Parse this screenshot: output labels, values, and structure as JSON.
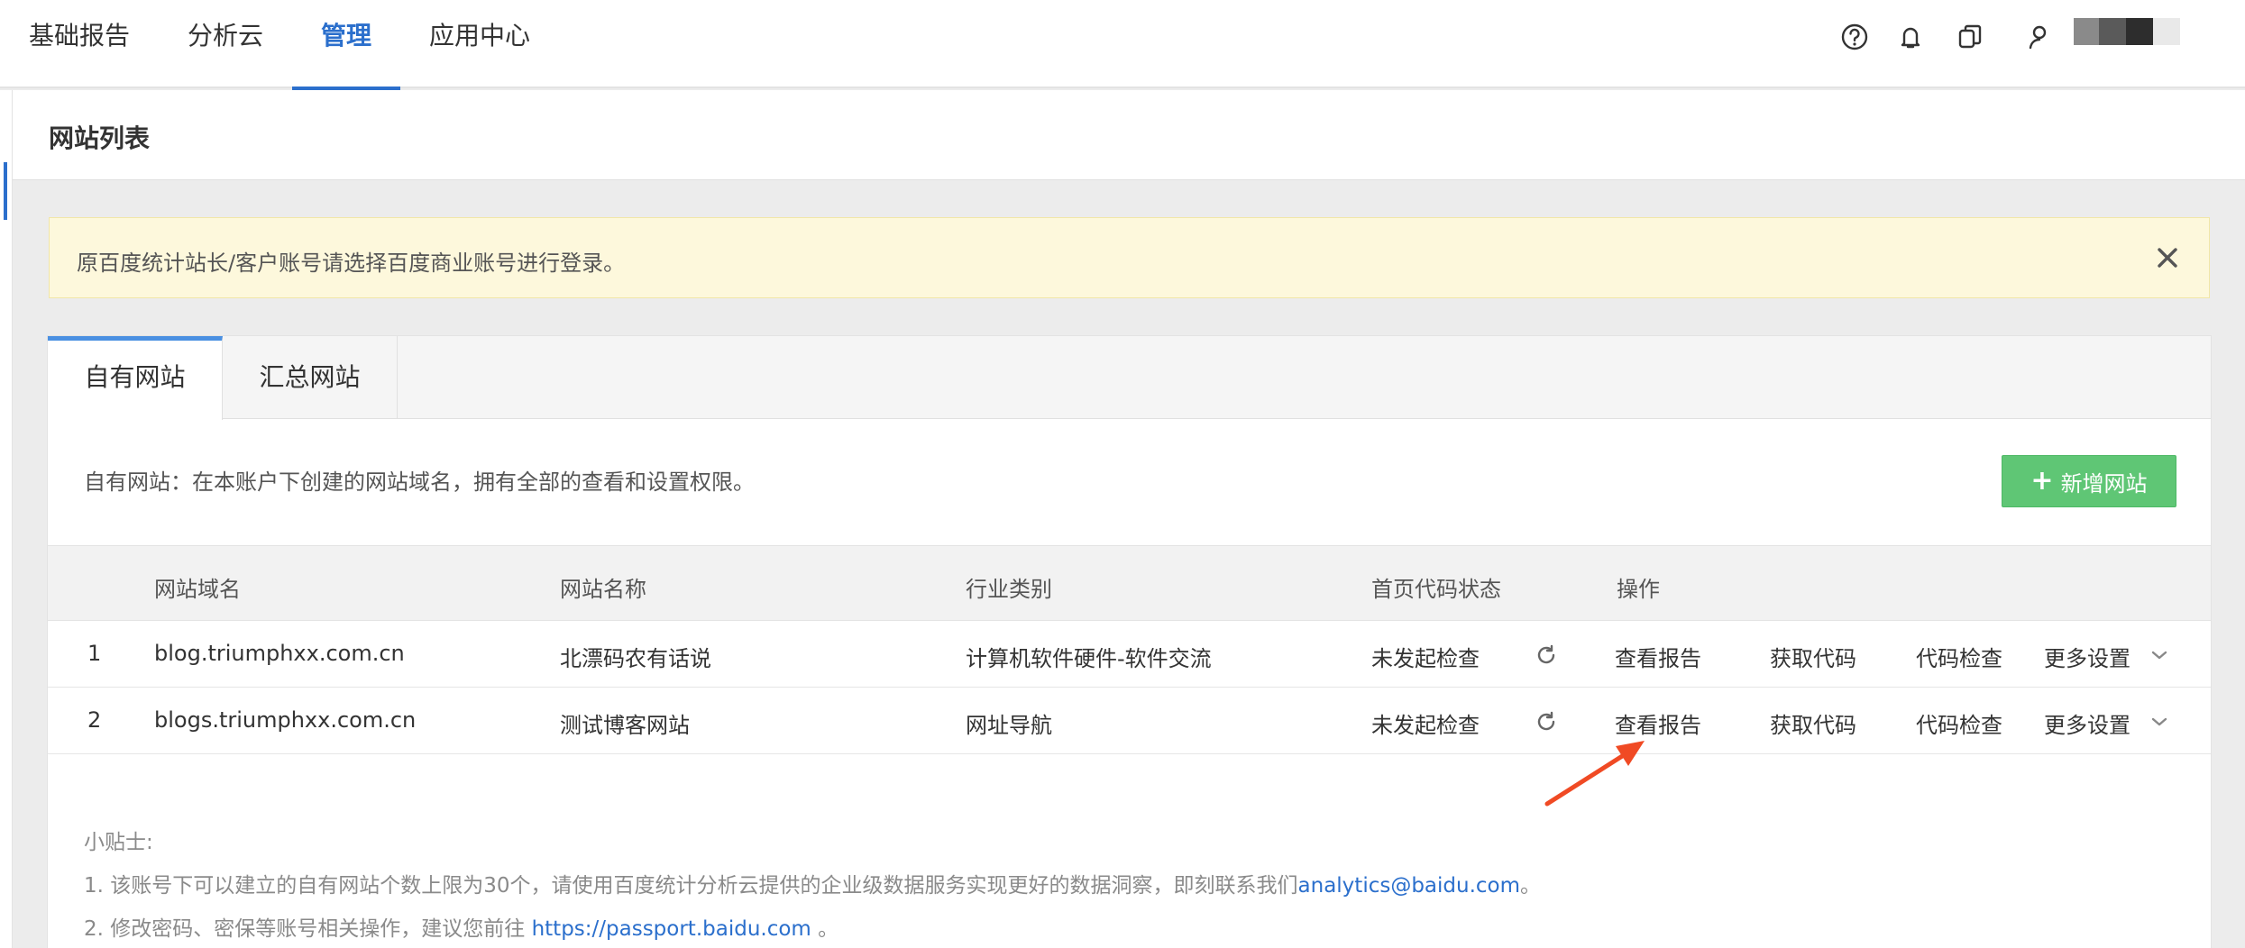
{
  "topnav": {
    "tabs": [
      {
        "label": "基础报告",
        "active": false
      },
      {
        "label": "分析云",
        "active": false
      },
      {
        "label": "管理",
        "active": true
      },
      {
        "label": "应用中心",
        "active": false
      }
    ],
    "icons": [
      "help-icon",
      "bell-icon",
      "copy-icon",
      "user-icon"
    ]
  },
  "page": {
    "title": "网站列表"
  },
  "notice": {
    "text": "原百度统计站长/客户账号请选择百度商业账号进行登录。"
  },
  "panel": {
    "tabs": [
      {
        "label": "自有网站",
        "active": true
      },
      {
        "label": "汇总网站",
        "active": false
      }
    ],
    "description": "自有网站：在本账户下创建的网站域名，拥有全部的查看和设置权限。",
    "add_button": "新增网站",
    "table": {
      "headers": [
        "网站域名",
        "网站名称",
        "行业类别",
        "首页代码状态",
        "操作"
      ],
      "rows": [
        {
          "index": "1",
          "domain": "blog.triumphxx.com.cn",
          "name": "北漂码农有话说",
          "category": "计算机软件硬件-软件交流",
          "status": "未发起检查",
          "actions": [
            "查看报告",
            "获取代码",
            "代码检查",
            "更多设置"
          ]
        },
        {
          "index": "2",
          "domain": "blogs.triumphxx.com.cn",
          "name": "测试博客网站",
          "category": "网址导航",
          "status": "未发起检查",
          "actions": [
            "查看报告",
            "获取代码",
            "代码检查",
            "更多设置"
          ]
        }
      ]
    },
    "tips": {
      "title": "小贴士:",
      "line1_text": "1. 该账号下可以建立的自有网站个数上限为30个，请使用百度统计分析云提供的企业级数据服务实现更好的数据洞察，即刻联系我们",
      "line1_link": "analytics@baidu.com",
      "line1_end": "。",
      "line2_text": "2. 修改密码、密保等账号相关操作，建议您前往 ",
      "line2_link": "https://passport.baidu.com",
      "line2_end": " 。"
    }
  },
  "colors": {
    "accent": "#2b6fcc",
    "add_button": "#5fc675",
    "notice_bg": "#fdf8dc",
    "annotation_arrow": "#f04a24"
  }
}
